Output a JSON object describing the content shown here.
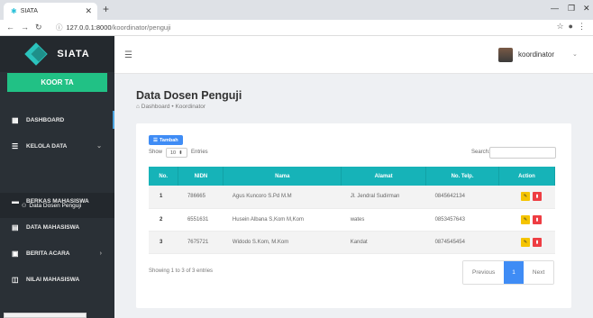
{
  "browser": {
    "tab_title": "SIATA",
    "url_host": "127.0.0.1:8000",
    "url_path": "/koordinator/penguji"
  },
  "sidebar": {
    "brand": "SIATA",
    "role": "KOOR TA",
    "items": [
      {
        "label": "DASHBOARD",
        "icon": "dashboard-icon"
      },
      {
        "label": "KELOLA DATA",
        "icon": "database-icon"
      },
      {
        "label": "BERKAS MAHASISWA",
        "icon": "folder-icon"
      },
      {
        "label": "DATA MAHASISWA",
        "icon": "file-icon"
      },
      {
        "label": "BERITA ACARA",
        "icon": "calendar-icon"
      },
      {
        "label": "NILAI MAHASISWA",
        "icon": "chart-icon"
      }
    ],
    "submenu_label": "Data Dosen Penguji"
  },
  "topnav": {
    "user_name": "koordinator"
  },
  "page": {
    "title": "Data Dosen Penguji",
    "breadcrumb_home": "Dashboard",
    "breadcrumb_current": "Koordinator"
  },
  "table_controls": {
    "add_button": "Tambah",
    "show_label": "Show",
    "show_value": "10",
    "entries_label": "Entries",
    "search_label": "Search:"
  },
  "table": {
    "headers": [
      "No.",
      "NIDN",
      "Nama",
      "Alamat",
      "No. Telp.",
      "Action"
    ],
    "rows": [
      {
        "no": "1",
        "nidn": "786665",
        "nama": "Agus Kuncoro S.Pd M.M",
        "alamat": "Jl. Jendral Sudirman",
        "telp": "0845642134"
      },
      {
        "no": "2",
        "nidn": "6551631",
        "nama": "Husein Albana S,Kom M,Kom",
        "alamat": "wates",
        "telp": "0853457643"
      },
      {
        "no": "3",
        "nidn": "7675721",
        "nama": "Widodo S.Kom, M.Kom",
        "alamat": "Kandat",
        "telp": "0874545454"
      }
    ]
  },
  "footer": {
    "showing": "Showing 1 to 3 of 3 entries",
    "previous": "Previous",
    "page": "1",
    "next": "Next"
  },
  "colors": {
    "sidebar_bg": "#2a3036",
    "role_badge": "#21c185",
    "table_header": "#16b3b8",
    "primary": "#3f8cf5",
    "edit": "#f5c400",
    "delete": "#ee3d43"
  }
}
